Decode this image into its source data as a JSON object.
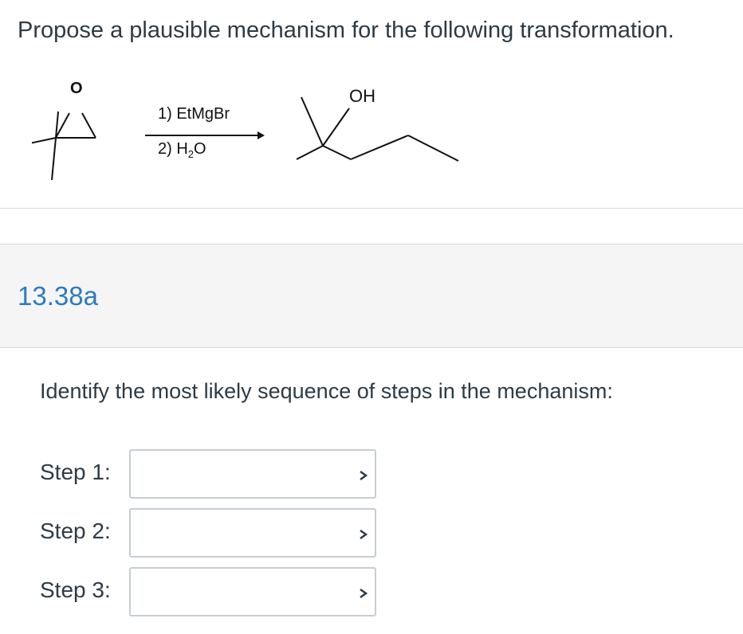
{
  "question": {
    "text": "Propose a plausible mechanism for the following transformation."
  },
  "scheme": {
    "reactant_atom": "O",
    "reagent_1": "1) EtMgBr",
    "reagent_2_prefix": "2) H",
    "reagent_2_subscript": "2",
    "reagent_2_suffix": "O",
    "product_group": "OH"
  },
  "section": {
    "label": "13.38a",
    "label_color": "#2b7abc"
  },
  "prompt": {
    "text": "Identify the most likely sequence of steps in the mechanism:"
  },
  "steps": [
    {
      "label": "Step 1:",
      "selected_value": "",
      "icon": "chevron-down-icon"
    },
    {
      "label": "Step 2:",
      "selected_value": "",
      "icon": "chevron-down-icon"
    },
    {
      "label": "Step 3:",
      "selected_value": "",
      "icon": "chevron-down-icon"
    }
  ]
}
